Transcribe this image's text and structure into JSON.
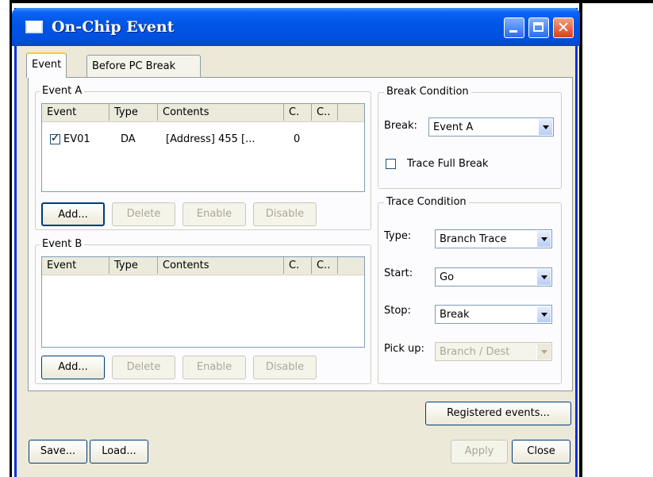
{
  "window": {
    "title": "On-Chip Event",
    "icon": "window-app-icon"
  },
  "tabs": [
    {
      "label": "Event",
      "active": true
    },
    {
      "label": "Before PC Break",
      "active": false
    }
  ],
  "event_a": {
    "group_label": "Event A",
    "columns": [
      "Event",
      "Type",
      "Contents",
      "C.",
      "C.."
    ],
    "rows": [
      {
        "checked": true,
        "event": "EV01",
        "type": "DA",
        "contents": "[Address] 455 [...",
        "c": "0",
        "c2": ""
      }
    ],
    "buttons": {
      "add": "Add...",
      "delete": "Delete",
      "enable": "Enable",
      "disable": "Disable"
    }
  },
  "event_b": {
    "group_label": "Event B",
    "columns": [
      "Event",
      "Type",
      "Contents",
      "C.",
      "C.."
    ],
    "rows": [],
    "buttons": {
      "add": "Add...",
      "delete": "Delete",
      "enable": "Enable",
      "disable": "Disable"
    }
  },
  "break_condition": {
    "group_label": "Break Condition",
    "break_label": "Break:",
    "break_value": "Event A",
    "trace_full_break_label": "Trace Full Break",
    "trace_full_break_checked": false
  },
  "trace_condition": {
    "group_label": "Trace Condition",
    "type_label": "Type:",
    "type_value": "Branch Trace",
    "start_label": "Start:",
    "start_value": "Go",
    "stop_label": "Stop:",
    "stop_value": "Break",
    "pickup_label": "Pick up:",
    "pickup_value": "Branch / Dest"
  },
  "footer": {
    "registered_events": "Registered events...",
    "save": "Save...",
    "load": "Load...",
    "apply": "Apply",
    "close": "Close"
  }
}
